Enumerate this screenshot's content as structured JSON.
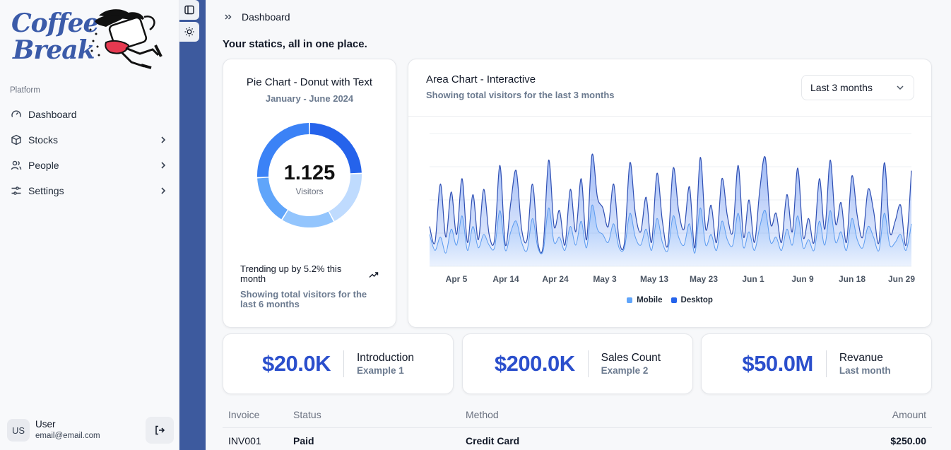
{
  "brand": {
    "line1": "Coffee",
    "line2": "Break"
  },
  "sidebar": {
    "section": "Platform",
    "items": [
      {
        "label": "Dashboard",
        "icon": "gauge-icon"
      },
      {
        "label": "Stocks",
        "icon": "box-icon"
      },
      {
        "label": "People",
        "icon": "users-icon"
      },
      {
        "label": "Settings",
        "icon": "sliders-icon"
      }
    ],
    "user": {
      "initials": "US",
      "name": "User",
      "email": "email@email.com"
    }
  },
  "breadcrumb": {
    "current": "Dashboard"
  },
  "headline": "Your statics, all in one place.",
  "pie_card": {
    "title": "Pie Chart - Donut with Text",
    "subtitle": "January - June 2024",
    "center_value": "1.125",
    "center_label": "Visitors",
    "trend": "Trending up by 5.2% this month",
    "footer": "Showing total visitors for the last 6 months"
  },
  "area_card": {
    "title": "Area Chart - Interactive",
    "subtitle": "Showing total visitors for the last 3 months",
    "range_select": "Last 3 months"
  },
  "stats": [
    {
      "value": "$20.0K",
      "label": "Introduction",
      "sublabel": "Example 1"
    },
    {
      "value": "$200.0K",
      "label": "Sales Count",
      "sublabel": "Example 2"
    },
    {
      "value": "$50.0M",
      "label": "Revanue",
      "sublabel": "Last month"
    }
  ],
  "table": {
    "headers": [
      "Invoice",
      "Status",
      "Method",
      "Amount"
    ],
    "rows": [
      [
        "INV001",
        "Paid",
        "Credit Card",
        "$250.00"
      ]
    ]
  },
  "colors": {
    "accent": "#2b4fcc",
    "sidebar_strip": "#3d5a9e",
    "desktop": "#2563eb",
    "mobile": "#60a5fa"
  },
  "chart_data": [
    {
      "type": "pie",
      "variant": "donut",
      "title": "Pie Chart - Donut with Text",
      "subtitle": "January - June 2024",
      "total": 1125,
      "slices": [
        {
          "value": 275,
          "color": "#2563eb"
        },
        {
          "value": 200,
          "color": "#bfdbfe"
        },
        {
          "value": 187,
          "color": "#93c5fd"
        },
        {
          "value": 173,
          "color": "#60a5fa"
        },
        {
          "value": 290,
          "color": "#3b82f6"
        }
      ]
    },
    {
      "type": "area",
      "title": "Area Chart - Interactive",
      "x_tick_labels": [
        "Apr 5",
        "Apr 14",
        "Apr 24",
        "May 3",
        "May 13",
        "May 23",
        "Jun 1",
        "Jun 9",
        "Jun 18",
        "Jun 29"
      ],
      "ylim": [
        0,
        500
      ],
      "grid": true,
      "legend": "bottom",
      "series": [
        {
          "name": "Mobile",
          "color": "#60a5fa",
          "values": [
            120,
            60,
            110,
            50,
            140,
            80,
            190,
            60,
            150,
            70,
            120,
            80,
            70,
            210,
            60,
            130,
            170,
            90,
            60,
            180,
            70,
            60,
            220,
            90,
            110,
            60,
            150,
            80,
            170,
            70,
            230,
            140,
            120,
            90,
            160,
            70,
            70,
            200,
            110,
            80,
            140,
            60,
            180,
            90,
            60,
            190,
            110,
            80,
            160,
            50,
            220,
            80,
            120,
            60,
            170,
            100,
            80,
            200,
            70,
            130,
            60,
            150,
            210,
            90,
            110,
            60,
            140,
            80,
            190,
            70,
            100,
            60,
            170,
            80,
            210,
            90,
            130,
            60,
            180,
            100,
            70,
            150,
            110,
            60,
            200,
            80,
            90,
            120,
            60,
            160
          ]
        },
        {
          "name": "Desktop",
          "color": "#2563eb",
          "values": [
            150,
            90,
            310,
            110,
            280,
            120,
            330,
            90,
            270,
            100,
            290,
            120,
            100,
            380,
            80,
            240,
            360,
            140,
            100,
            310,
            90,
            80,
            400,
            150,
            210,
            80,
            290,
            130,
            330,
            100,
            420,
            260,
            220,
            150,
            310,
            100,
            90,
            390,
            200,
            130,
            260,
            90,
            350,
            170,
            80,
            370,
            210,
            140,
            300,
            70,
            410,
            140,
            230,
            90,
            330,
            190,
            130,
            380,
            110,
            250,
            90,
            290,
            410,
            160,
            200,
            90,
            270,
            130,
            370,
            110,
            180,
            90,
            330,
            140,
            400,
            160,
            240,
            90,
            340,
            190,
            110,
            290,
            210,
            90,
            390,
            130,
            170,
            230,
            80,
            360
          ]
        }
      ]
    }
  ]
}
